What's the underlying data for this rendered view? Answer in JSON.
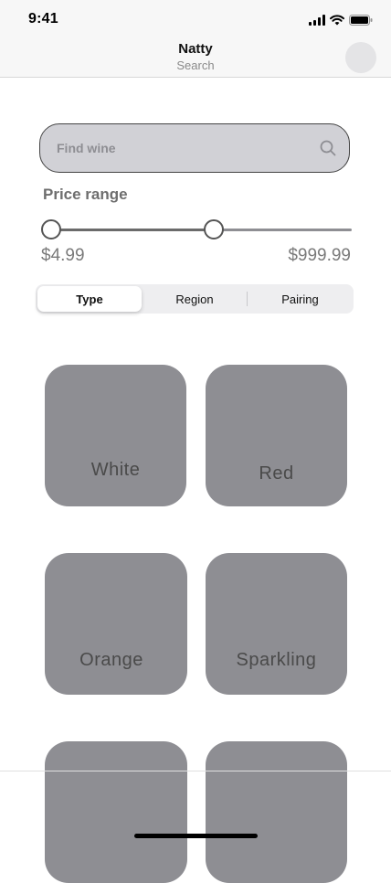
{
  "status_bar": {
    "time": "9:41",
    "icons": [
      "cellular-signal-icon",
      "wifi-icon",
      "battery-icon"
    ]
  },
  "nav": {
    "title": "Natty",
    "subtitle": "Search"
  },
  "search": {
    "placeholder": "Find wine",
    "value": "",
    "icon": "search-icon"
  },
  "price_range": {
    "label": "Price range",
    "min_label": "$4.99",
    "max_label": "$999.99",
    "low_fraction": 0.0,
    "high_fraction": 0.56
  },
  "segmented": {
    "options": [
      "Type",
      "Region",
      "Pairing"
    ],
    "selected": "Type"
  },
  "wine_types": [
    "White",
    "Red",
    "Orange",
    "Sparkling",
    "",
    ""
  ],
  "colors": {
    "tile": "#8e8e93",
    "search_fill": "#d1d1d6",
    "background": "#ffffff"
  }
}
